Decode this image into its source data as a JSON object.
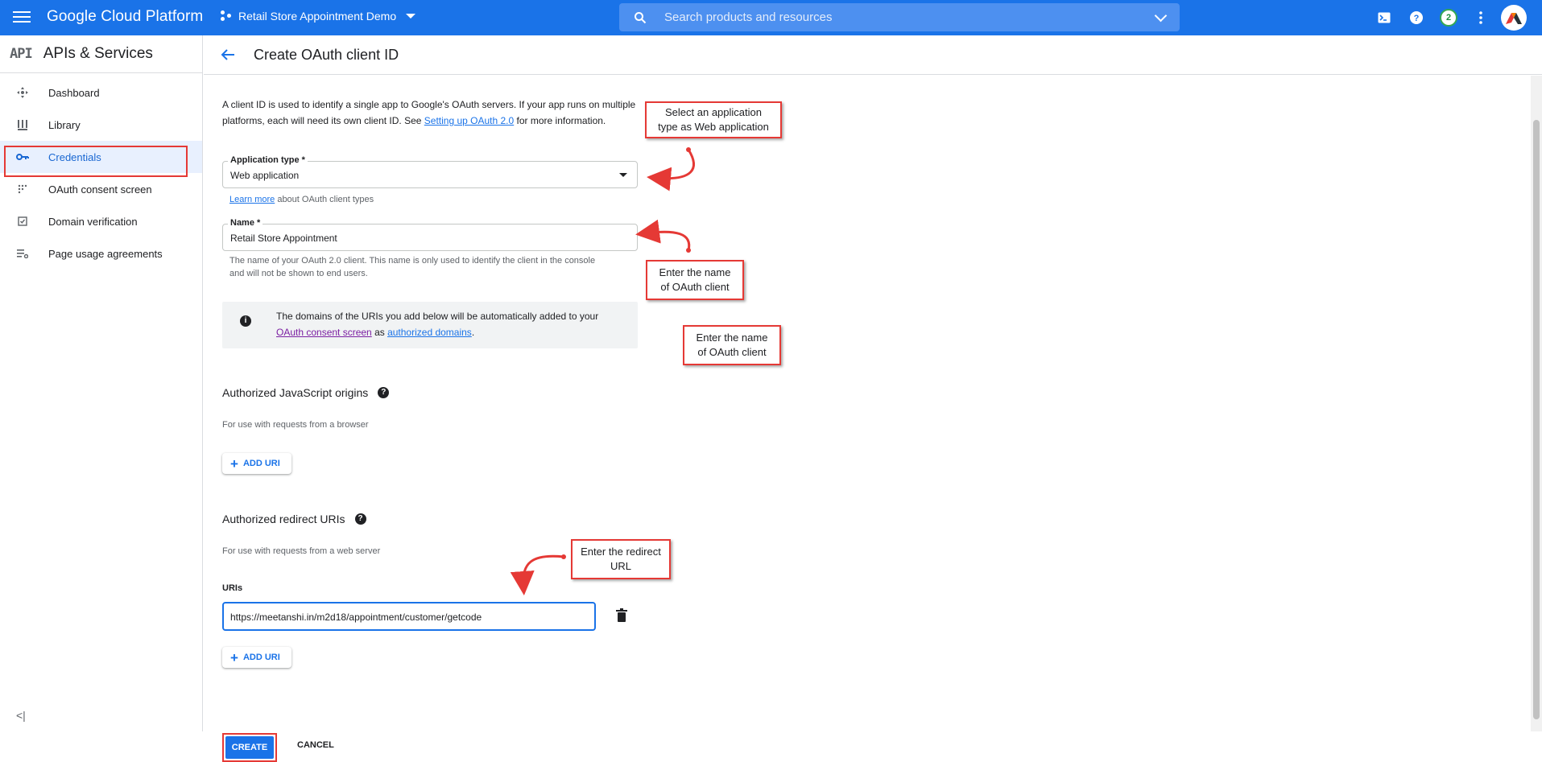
{
  "topbar": {
    "brand": "Google Cloud Platform",
    "project": "Retail Store Appointment Demo",
    "search_placeholder": "Search products and resources",
    "notification_count": "2"
  },
  "sidebar": {
    "logo": "API",
    "title": "APIs & Services",
    "items": [
      {
        "label": "Dashboard",
        "icon": "dashboard-icon"
      },
      {
        "label": "Library",
        "icon": "library-icon"
      },
      {
        "label": "Credentials",
        "icon": "key-icon"
      },
      {
        "label": "OAuth consent screen",
        "icon": "consent-icon"
      },
      {
        "label": "Domain verification",
        "icon": "checkbox-icon"
      },
      {
        "label": "Page usage agreements",
        "icon": "settings-list-icon"
      }
    ],
    "collapse": "<|"
  },
  "page": {
    "title": "Create OAuth client ID",
    "desc_1": "A client ID is used to identify a single app to Google's OAuth servers. If your app runs on multiple platforms, each will need its own client ID. See ",
    "desc_link": "Setting up OAuth 2.0",
    "desc_2": " for more information.",
    "app_type_label": "Application type *",
    "app_type_value": "Web application",
    "learn_more": "Learn more",
    "learn_more_rest": " about OAuth client types",
    "name_label": "Name *",
    "name_value": "Retail Store Appointment",
    "name_hint": "The name of your OAuth 2.0 client. This name is only used to identify the client in the console and will not be shown to end users.",
    "info_1": "The domains of the URIs you add below will be automatically added to your ",
    "info_link_1": "OAuth consent screen",
    "info_2": " as ",
    "info_link_2": "authorized domains",
    "info_3": ".",
    "js_origins_title": "Authorized JavaScript origins",
    "js_origins_sub": "For use with requests from a browser",
    "add_uri": "ADD URI",
    "redirect_title": "Authorized redirect URIs",
    "redirect_sub": "For use with requests from a web server",
    "uris_label": "URIs",
    "uri_value": "https://meetanshi.in/m2d18/appointment/customer/getcode",
    "create": "CREATE",
    "cancel": "CANCEL"
  },
  "callouts": {
    "app_type": "Select an application\ntype as Web application",
    "name": "Enter the name\nof OAuth client",
    "name_2": "Enter the name\nof OAuth client",
    "redirect": "Enter the redirect\nURL"
  },
  "colors": {
    "primary": "#1a73e8",
    "annotation": "#e53935"
  }
}
